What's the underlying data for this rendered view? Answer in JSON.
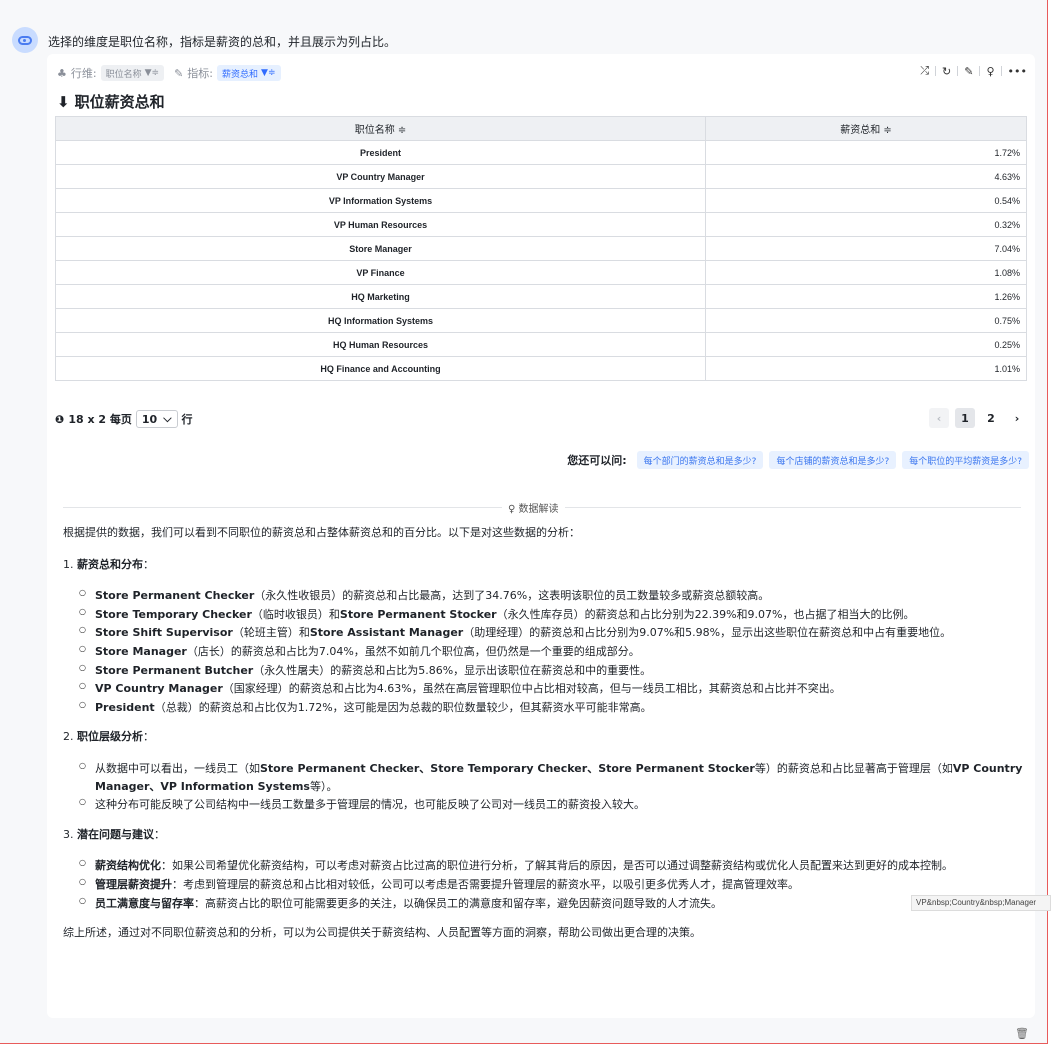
{
  "question": "选择的维度是职位名称，指标是薪资的总和，并且展示为列占比。",
  "toolbar": {
    "dim_label": "行维:",
    "dim_value": "职位名称",
    "metric_label": "指标:",
    "metric_value": "薪资总和"
  },
  "title": "职位薪资总和",
  "table": {
    "headers": [
      "职位名称 ≑",
      "薪资总和 ≑"
    ],
    "rows": [
      [
        "President",
        "1.72%"
      ],
      [
        "VP Country Manager",
        "4.63%"
      ],
      [
        "VP Information Systems",
        "0.54%"
      ],
      [
        "VP Human Resources",
        "0.32%"
      ],
      [
        "Store Manager",
        "7.04%"
      ],
      [
        "VP Finance",
        "1.08%"
      ],
      [
        "HQ Marketing",
        "1.26%"
      ],
      [
        "HQ Information Systems",
        "0.75%"
      ],
      [
        "HQ Human Resources",
        "0.25%"
      ],
      [
        "HQ Finance and Accounting",
        "1.01%"
      ]
    ]
  },
  "pager": {
    "summary": "18 x 2 每页",
    "page_size": "10",
    "unit": "行",
    "pages": [
      "1",
      "2"
    ],
    "current": "1"
  },
  "suggest": {
    "label": "您还可以问:",
    "chips": [
      "每个部门的薪资总和是多少?",
      "每个店铺的薪资总和是多少?",
      "每个职位的平均薪资是多少?"
    ]
  },
  "interpretation_label": "数据解读",
  "analysis": {
    "intro": "根据提供的数据，我们可以看到不同职位的薪资总和占整体薪资总和的百分比。以下是对这些数据的分析：",
    "s1_num": "1.",
    "s1_title": "薪资总和分布",
    "s1_items": [
      {
        "b": "Store Permanent Checker",
        "t": "（永久性收银员）的薪资总和占比最高，达到了34.76%，这表明该职位的员工数量较多或薪资总额较高。"
      },
      {
        "b": "Store Temporary Checker",
        "t": "（临时收银员）和",
        "b2": "Store Permanent Stocker",
        "t2": "（永久性库存员）的薪资总和占比分别为22.39%和9.07%，也占据了相当大的比例。"
      },
      {
        "b": "Store Shift Supervisor",
        "t": "（轮班主管）和",
        "b2": "Store Assistant Manager",
        "t2": "（助理经理）的薪资总和占比分别为9.07%和5.98%，显示出这些职位在薪资总和中占有重要地位。"
      },
      {
        "b": "Store Manager",
        "t": "（店长）的薪资总和占比为7.04%，虽然不如前几个职位高，但仍然是一个重要的组成部分。"
      },
      {
        "b": "Store Permanent Butcher",
        "t": "（永久性屠夫）的薪资总和占比为5.86%，显示出该职位在薪资总和中的重要性。"
      },
      {
        "b": "VP Country Manager",
        "t": "（国家经理）的薪资总和占比为4.63%，虽然在高层管理职位中占比相对较高，但与一线员工相比，其薪资总和占比并不突出。"
      },
      {
        "b": "President",
        "t": "（总裁）的薪资总和占比仅为1.72%，这可能是因为总裁的职位数量较少，但其薪资水平可能非常高。"
      }
    ],
    "s2_num": "2.",
    "s2_title": "职位层级分析",
    "s2_item1_a": "从数据中可以看出，一线员工（如",
    "s2_item1_b": "Store Permanent Checker、Store Temporary Checker、Store Permanent Stocker",
    "s2_item1_c": "等）的薪资总和占比显著高于管理层（如",
    "s2_item1_d": "VP Country Manager、VP Information Systems",
    "s2_item1_e": "等）。",
    "s2_item2": "这种分布可能反映了公司结构中一线员工数量多于管理层的情况，也可能反映了公司对一线员工的薪资投入较大。",
    "s3_num": "3.",
    "s3_title": "潜在问题与建议",
    "s3_items": [
      {
        "b": "薪资结构优化",
        "t": "：如果公司希望优化薪资结构，可以考虑对薪资占比过高的职位进行分析，了解其背后的原因，是否可以通过调整薪资结构或优化人员配置来达到更好的成本控制。"
      },
      {
        "b": "管理层薪资提升",
        "t": "：考虑到管理层的薪资总和占比相对较低，公司可以考虑是否需要提升管理层的薪资水平，以吸引更多优秀人才，提高管理效率。"
      },
      {
        "b": "员工满意度与留存率",
        "t": "：高薪资占比的职位可能需要更多的关注，以确保员工的满意度和留存率，避免因薪资问题导致的人才流失。"
      }
    ],
    "conclusion": "综上所述，通过对不同职位薪资总和的分析，可以为公司提供关于薪资结构、人员配置等方面的洞察，帮助公司做出更合理的决策。"
  },
  "tooltip": "VP&nbsp;Country&nbsp;Manager"
}
